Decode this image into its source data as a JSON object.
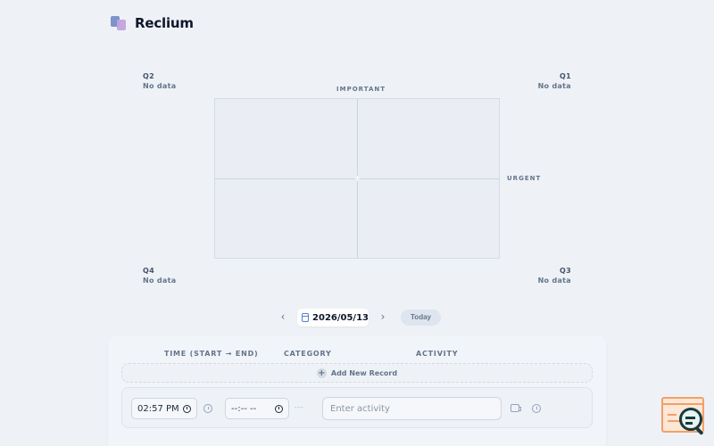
{
  "app": {
    "name": "Reclium"
  },
  "matrix": {
    "q1": {
      "label": "Q1",
      "value": "No data"
    },
    "q2": {
      "label": "Q2",
      "value": "No data"
    },
    "q3": {
      "label": "Q3",
      "value": "No data"
    },
    "q4": {
      "label": "Q4",
      "value": "No data"
    },
    "axis_important": "IMPORTANT",
    "axis_urgent": "URGENT"
  },
  "date_nav": {
    "prev_icon": "chevron-left-icon",
    "next_icon": "chevron-right-icon",
    "date": "2026/05/13",
    "today_label": "Today"
  },
  "records": {
    "headers": {
      "time": "TIME (START → END)",
      "category": "CATEGORY",
      "activity": "ACTIVITY"
    },
    "add_label": "Add New Record",
    "row": {
      "start_time": "02:57 PM",
      "end_time": "--:-- --",
      "duration": "---",
      "activity_placeholder": "Enter activity"
    }
  }
}
